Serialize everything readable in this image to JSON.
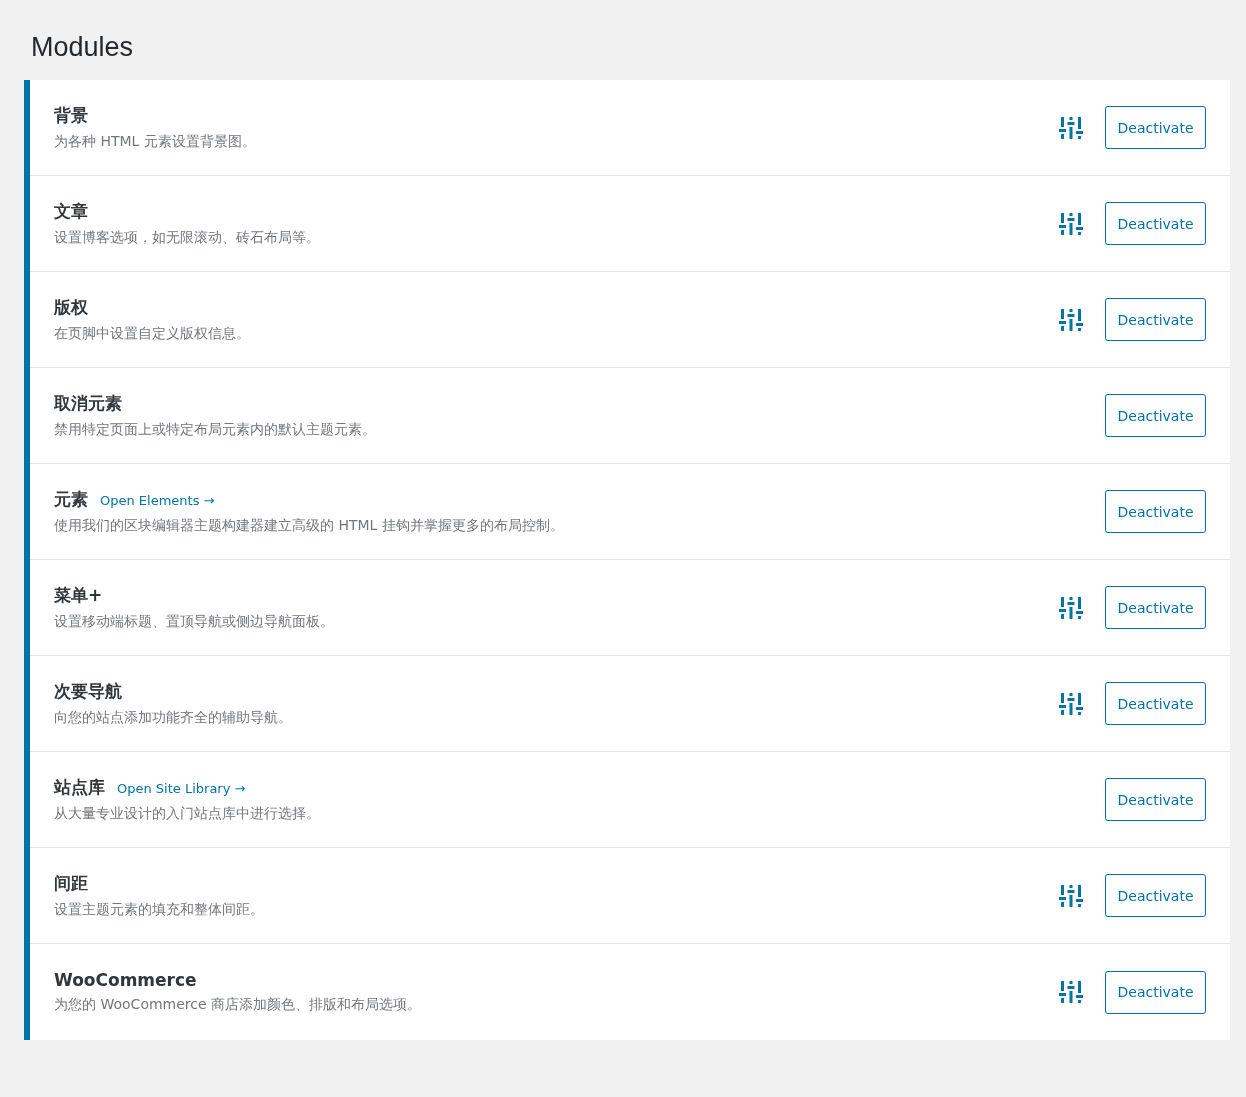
{
  "heading": "Modules",
  "modules": [
    {
      "title": "背景",
      "description": "为各种 HTML 元素设置背景图。",
      "settings": true,
      "button": "Deactivate"
    },
    {
      "title": "文章",
      "description": "设置博客选项，如无限滚动、砖石布局等。",
      "settings": true,
      "button": "Deactivate"
    },
    {
      "title": "版权",
      "description": "在页脚中设置自定义版权信息。",
      "settings": true,
      "button": "Deactivate"
    },
    {
      "title": "取消元素",
      "description": "禁用特定页面上或特定布局元素内的默认主题元素。",
      "settings": false,
      "button": "Deactivate"
    },
    {
      "title": "元素",
      "link": "Open Elements →",
      "description": "使用我们的区块编辑器主题构建器建立高级的 HTML 挂钩并掌握更多的布局控制。",
      "settings": false,
      "button": "Deactivate"
    },
    {
      "title": "菜单+",
      "description": "设置移动端标题、置顶导航或侧边导航面板。",
      "settings": true,
      "button": "Deactivate"
    },
    {
      "title": "次要导航",
      "description": "向您的站点添加功能齐全的辅助导航。",
      "settings": true,
      "button": "Deactivate"
    },
    {
      "title": "站点库",
      "link": "Open Site Library →",
      "description": "从大量专业设计的入门站点库中进行选择。",
      "settings": false,
      "button": "Deactivate"
    },
    {
      "title": "间距",
      "description": "设置主题元素的填充和整体间距。",
      "settings": true,
      "button": "Deactivate"
    },
    {
      "title": "WooCommerce",
      "description": "为您的 WooCommerce 商店添加颜色、排版和布局选项。",
      "settings": true,
      "button": "Deactivate"
    }
  ]
}
